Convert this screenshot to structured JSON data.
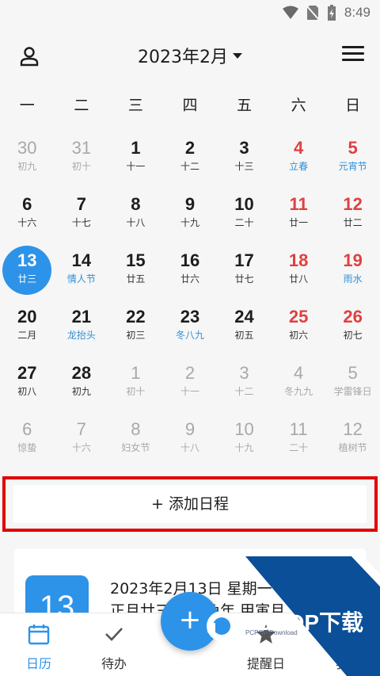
{
  "status": {
    "time": "8:49"
  },
  "header": {
    "title": "2023年2月"
  },
  "weekdays": [
    "一",
    "二",
    "三",
    "四",
    "五",
    "六",
    "日"
  ],
  "calendar": {
    "weeks": [
      [
        {
          "n": "30",
          "l": "初九",
          "other": true
        },
        {
          "n": "31",
          "l": "初十",
          "other": true
        },
        {
          "n": "1",
          "l": "十一"
        },
        {
          "n": "2",
          "l": "十二"
        },
        {
          "n": "3",
          "l": "十三"
        },
        {
          "n": "4",
          "l": "立春",
          "weekend": true,
          "fest": true
        },
        {
          "n": "5",
          "l": "元宵节",
          "weekend": true,
          "fest": true
        }
      ],
      [
        {
          "n": "6",
          "l": "十六"
        },
        {
          "n": "7",
          "l": "十七"
        },
        {
          "n": "8",
          "l": "十八"
        },
        {
          "n": "9",
          "l": "十九"
        },
        {
          "n": "10",
          "l": "二十"
        },
        {
          "n": "11",
          "l": "廿一",
          "weekend": true
        },
        {
          "n": "12",
          "l": "廿二",
          "weekend": true
        }
      ],
      [
        {
          "n": "13",
          "l": "廿三",
          "today": true
        },
        {
          "n": "14",
          "l": "情人节",
          "fest": true
        },
        {
          "n": "15",
          "l": "廿五"
        },
        {
          "n": "16",
          "l": "廿六"
        },
        {
          "n": "17",
          "l": "廿七"
        },
        {
          "n": "18",
          "l": "廿八",
          "weekend": true
        },
        {
          "n": "19",
          "l": "雨水",
          "weekend": true,
          "fest": true
        }
      ],
      [
        {
          "n": "20",
          "l": "二月"
        },
        {
          "n": "21",
          "l": "龙抬头",
          "fest": true
        },
        {
          "n": "22",
          "l": "初三"
        },
        {
          "n": "23",
          "l": "冬八九",
          "fest": true
        },
        {
          "n": "24",
          "l": "初五"
        },
        {
          "n": "25",
          "l": "初六",
          "weekend": true
        },
        {
          "n": "26",
          "l": "初七",
          "weekend": true
        }
      ],
      [
        {
          "n": "27",
          "l": "初八"
        },
        {
          "n": "28",
          "l": "初九"
        },
        {
          "n": "1",
          "l": "初十",
          "other": true
        },
        {
          "n": "2",
          "l": "十一",
          "other": true
        },
        {
          "n": "3",
          "l": "十二",
          "other": true
        },
        {
          "n": "4",
          "l": "冬九九",
          "other": true
        },
        {
          "n": "5",
          "l": "学雷锋日",
          "other": true
        }
      ],
      [
        {
          "n": "6",
          "l": "惊蛰",
          "other": true
        },
        {
          "n": "7",
          "l": "十六",
          "other": true
        },
        {
          "n": "8",
          "l": "妇女节",
          "other": true
        },
        {
          "n": "9",
          "l": "十八",
          "other": true
        },
        {
          "n": "10",
          "l": "十九",
          "other": true
        },
        {
          "n": "11",
          "l": "二十",
          "other": true
        },
        {
          "n": "12",
          "l": "植树节",
          "other": true
        }
      ]
    ]
  },
  "add_schedule": {
    "label": "+ 添加日程"
  },
  "event_card": {
    "day": "13",
    "line1": "2023年2月13日 星期一",
    "line2": "正月廿三 癸卯兔年 甲寅月"
  },
  "nav": {
    "calendar": "日历",
    "todo": "待办",
    "remind": "提醒日",
    "mine": "我",
    "fab": "+"
  },
  "watermark": {
    "brand": "PCPOP下载",
    "sub": "PCPOP Download"
  },
  "colors": {
    "accent": "#2d93e8",
    "weekend": "#e04040",
    "highlight_border": "#e00000",
    "watermark_blue": "#0a4f98"
  }
}
